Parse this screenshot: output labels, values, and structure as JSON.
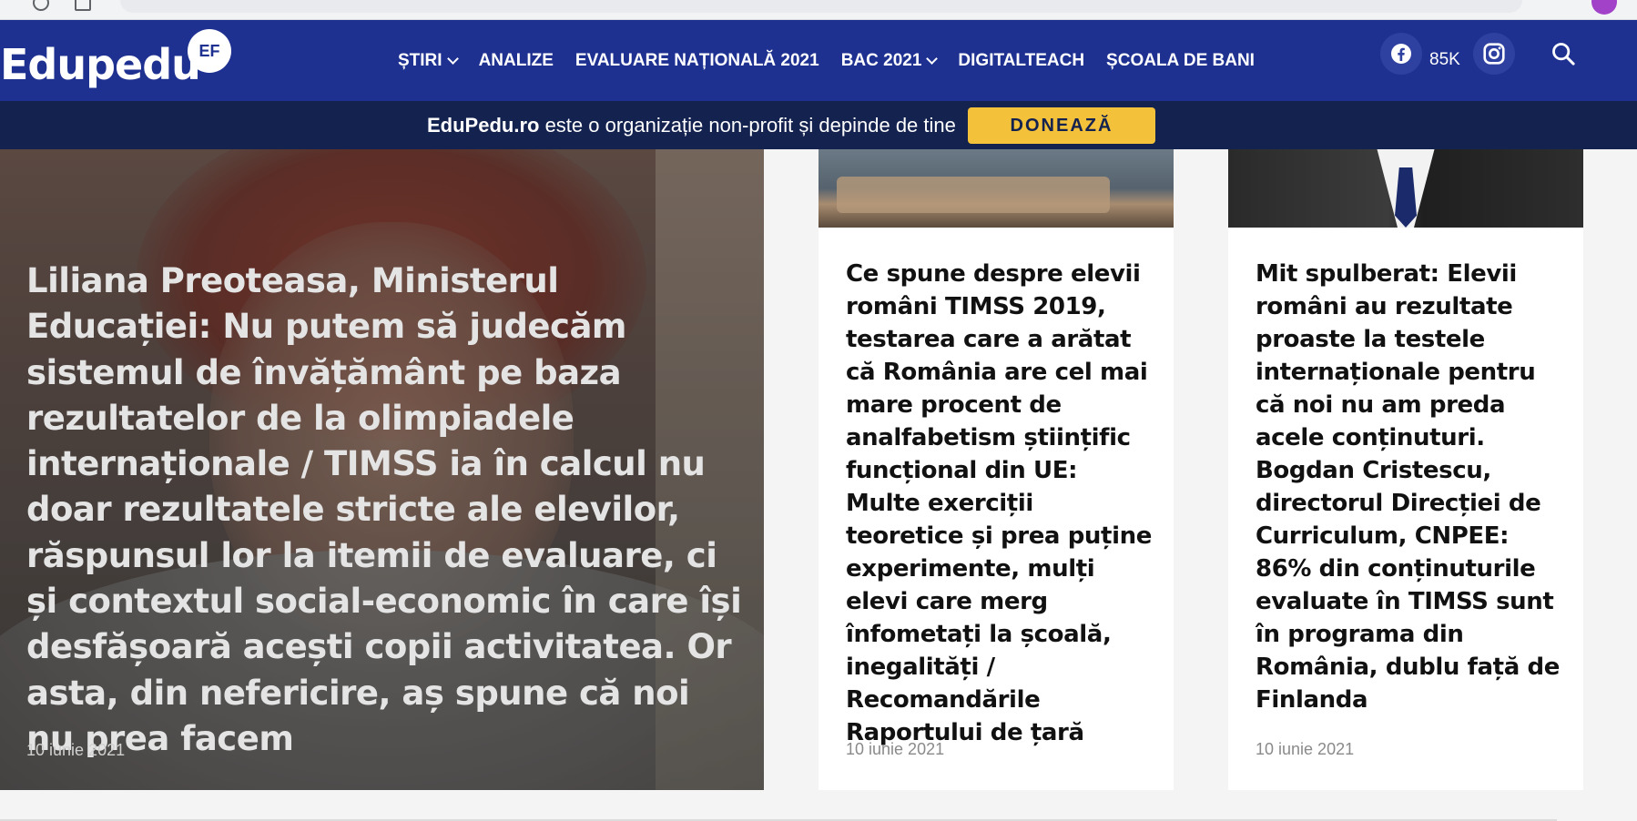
{
  "header": {
    "logo_text": "Edupedu",
    "logo_badge": "EF",
    "nav": [
      {
        "label": "ȘTIRI",
        "dropdown": true
      },
      {
        "label": "ANALIZE",
        "dropdown": false
      },
      {
        "label": "EVALUARE NAȚIONALĂ 2021",
        "dropdown": false
      },
      {
        "label": "BAC 2021",
        "dropdown": true
      },
      {
        "label": "DIGITALTEACH",
        "dropdown": false
      },
      {
        "label": "ȘCOALA DE BANI",
        "dropdown": false
      }
    ],
    "facebook_count": "85K",
    "icons": [
      "facebook-icon",
      "instagram-icon",
      "search-icon"
    ]
  },
  "donate": {
    "site": "EduPedu.ro",
    "text": " este o organizație non-profit și depinde de tine",
    "button": "DONEAZĂ"
  },
  "hero": {
    "title": "Liliana Preoteasa, Ministerul Educației: Nu putem să judecăm sistemul de învățământ pe baza rezultatelor de la olimpiadele internaționale / TIMSS ia în calcul nu doar rezultatele stricte ale elevilor, răspunsul lor la itemii de evaluare, ci și contextul social-economic în care își desfășoară acești copii activitatea. Or asta, din nefericire, aș spune că noi nu prea facem",
    "date": "10 iunie 2021"
  },
  "cards": [
    {
      "title": "Ce spune despre elevii români TIMSS 2019, testarea care a arătat că România are cel mai mare procent de analfabetism științific funcțional din UE: Multe exerciții teoretice și prea puține experimente, mulți elevi care merg înfometați la școală, inegalități / Recomandările Raportului de țară",
      "date": "10 iunie 2021"
    },
    {
      "title": "Mit spulberat: Elevii români au rezultate proaste la testele internaționale pentru că noi nu am preda acele conținuturi. Bogdan Cristescu, directorul Direcției de Curriculum, CNPEE: 86% din conținuturile evaluate în TIMSS sunt în programa din România, dublu față de Finlanda",
      "date": "10 iunie 2021"
    }
  ],
  "colors": {
    "header_bg": "#1e3191",
    "donate_bar_bg": "#14224f",
    "donate_button": "#f3c13a"
  }
}
